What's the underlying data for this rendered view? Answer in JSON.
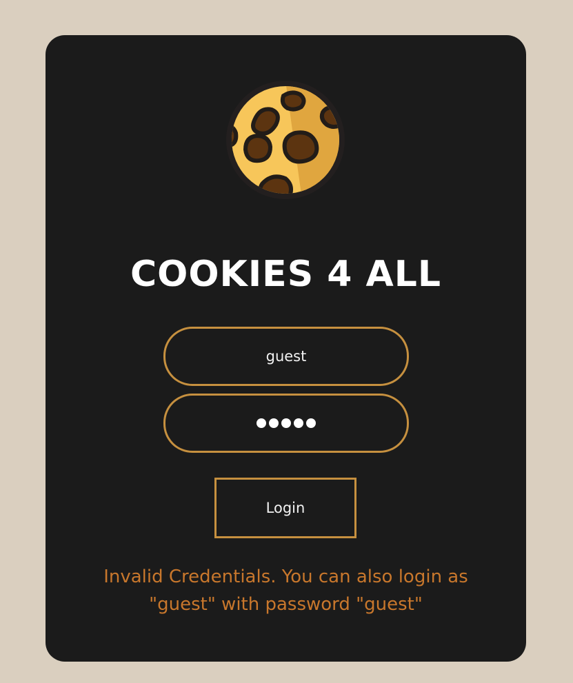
{
  "page": {
    "background_color": "#dacfbf",
    "card_color": "#1b1b1b",
    "accent_color": "#c6903f",
    "error_color": "#c8772c"
  },
  "logo": {
    "icon": "cookie-icon"
  },
  "title": "COOKIES 4 ALL",
  "form": {
    "username_value": "guest",
    "password_masked_length": 5,
    "login_label": "Login"
  },
  "message": {
    "line1": "Invalid Credentials. You can also login as",
    "line2": "\"guest\" with password \"guest\""
  }
}
